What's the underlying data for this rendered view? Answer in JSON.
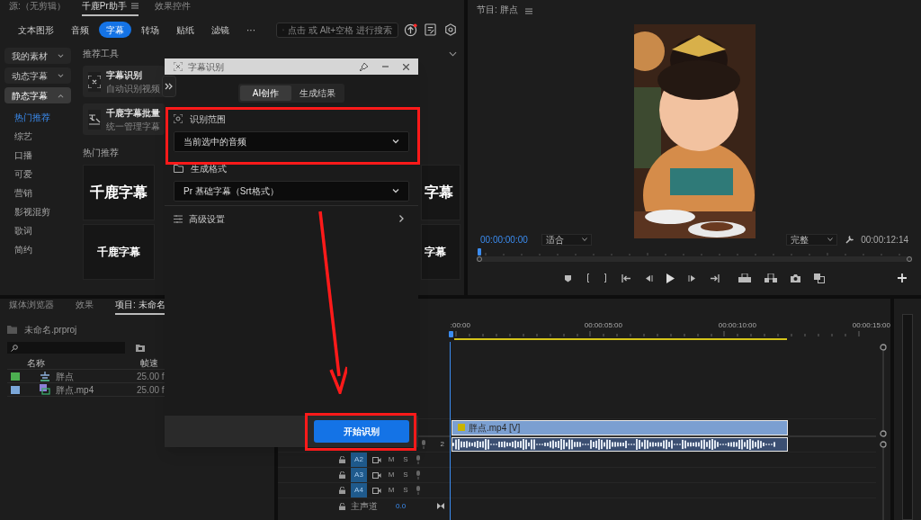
{
  "source_tabs": [
    {
      "label": "源:（无剪辑）",
      "selected": false
    },
    {
      "label": "千鹿Pr助手",
      "selected": true
    },
    {
      "label": "效果控件",
      "selected": false
    }
  ],
  "categories": [
    {
      "label": "文本图形",
      "selected": false
    },
    {
      "label": "音频",
      "selected": false
    },
    {
      "label": "字幕",
      "selected": true
    },
    {
      "label": "转场",
      "selected": false
    },
    {
      "label": "贴纸",
      "selected": false
    },
    {
      "label": "滤镜",
      "selected": false
    },
    {
      "label": "···",
      "selected": false
    }
  ],
  "search": {
    "placeholder": "点击 或 Alt+空格 进行搜索"
  },
  "sidebar": {
    "groups": [
      {
        "label": "我的素材",
        "expanded": false
      },
      {
        "label": "动态字幕",
        "expanded": false
      },
      {
        "label": "静态字幕",
        "expanded": true
      }
    ],
    "items": [
      {
        "label": "热门推荐",
        "selected": true
      },
      {
        "label": "综艺",
        "selected": false
      },
      {
        "label": "口播",
        "selected": false
      },
      {
        "label": "可爱",
        "selected": false
      },
      {
        "label": "营销",
        "selected": false
      },
      {
        "label": "影视混剪",
        "selected": false
      },
      {
        "label": "歌词",
        "selected": false
      },
      {
        "label": "简约",
        "selected": false
      }
    ]
  },
  "tools": {
    "title": "推荐工具",
    "cards": [
      {
        "title": "字幕识别",
        "subtitle": "自动识别视频"
      },
      {
        "title": "千鹿字幕批量",
        "subtitle": "统一管理字幕"
      }
    ]
  },
  "hot": {
    "title": "热门推荐",
    "rows": [
      {
        "left": "千鹿字幕",
        "right": "字幕",
        "kind": "large"
      },
      {
        "left": "千鹿字幕",
        "right": "字幕",
        "kind": "medium"
      }
    ]
  },
  "dialog": {
    "title": "字幕识别",
    "tabs": [
      {
        "label": "AI创作",
        "selected": true
      },
      {
        "label": "生成结果",
        "selected": false
      }
    ],
    "fields": [
      {
        "label": "识别范围",
        "value": "当前选中的音频"
      },
      {
        "label": "生成格式",
        "value": "Pr 基础字幕（Srt格式）"
      }
    ],
    "advanced": "高级设置",
    "start_button": "开始识别"
  },
  "program": {
    "title": "节目: 胖点",
    "timecode": "00:00:00:00",
    "zoom": "适合",
    "quality": "完整",
    "duration": "00:00:12:14"
  },
  "project": {
    "tabs": [
      {
        "label": "媒体浏览器",
        "selected": false
      },
      {
        "label": "效果",
        "selected": false
      },
      {
        "label": "项目: 未命名",
        "selected": true
      }
    ],
    "file": "未命名.prproj",
    "columns": [
      "名称",
      "帧速"
    ],
    "rows": [
      {
        "name": "胖点",
        "rate": "25.00 f",
        "color": "#4caf50",
        "kind": "sequence"
      },
      {
        "name": "胖点.mp4",
        "rate": "25.00 f",
        "color": "#7ba7d9",
        "kind": "clip"
      }
    ]
  },
  "timeline": {
    "ruler": [
      ":00:00",
      "00:00:05:00",
      "00:00:10:00",
      "00:00:15:00"
    ],
    "video_clip": "胖点.mp4 [V]",
    "a1_number": "2",
    "tracks": [
      {
        "name": "A2",
        "targeted": true,
        "mute": "M",
        "solo": "S"
      },
      {
        "name": "A3",
        "targeted": true,
        "mute": "M",
        "solo": "S"
      },
      {
        "name": "A4",
        "targeted": true,
        "mute": "M",
        "solo": "S"
      }
    ],
    "master": {
      "label": "主声道",
      "value": "0.0"
    }
  }
}
